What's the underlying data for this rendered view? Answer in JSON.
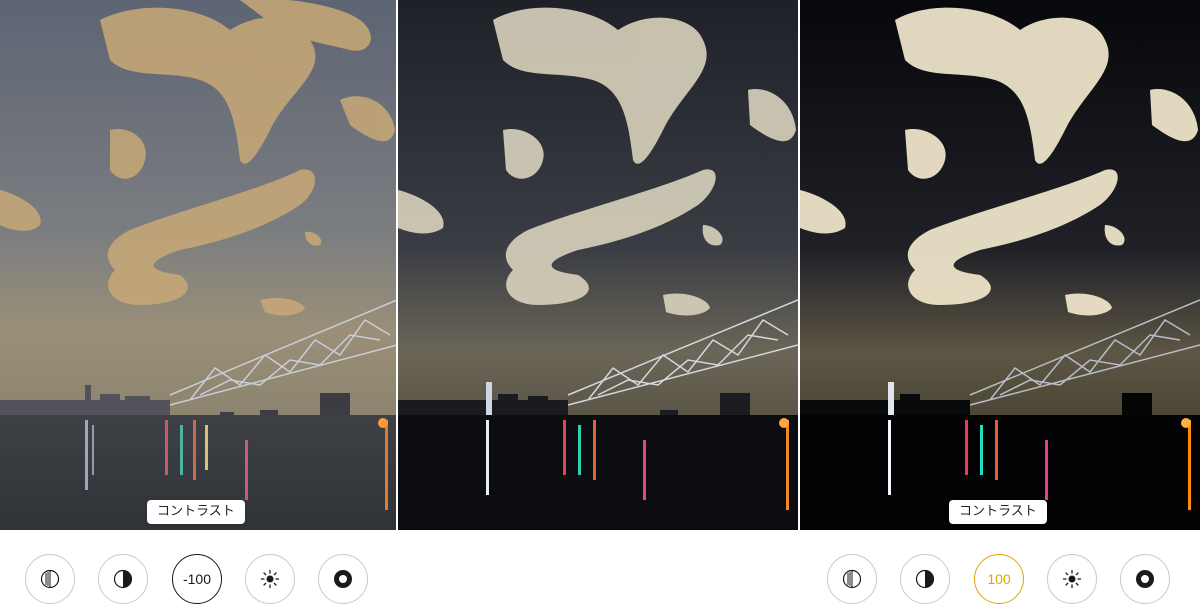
{
  "left": {
    "badge": "コントラスト",
    "value_label": "-100"
  },
  "right": {
    "badge": "コントラスト",
    "value_label": "100"
  },
  "colors": {
    "active_dark": "#1a1a1a",
    "active_gold": "#e0a600",
    "button_border": "#c9c9c9"
  },
  "icons": [
    "exposure-icon",
    "brilliance-icon",
    "contrast-value",
    "brightness-icon",
    "black-point-icon"
  ]
}
